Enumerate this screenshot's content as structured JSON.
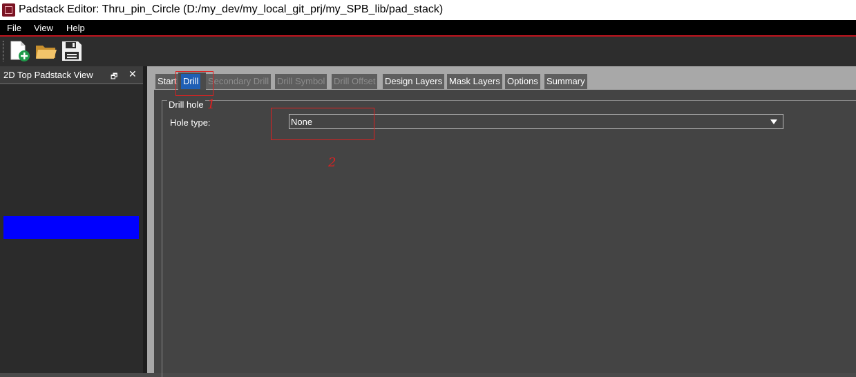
{
  "window": {
    "title": "Padstack Editor: Thru_pin_Circle  (D:/my_dev/my_local_git_prj/my_SPB_lib/pad_stack)"
  },
  "menu": [
    "File",
    "View",
    "Help"
  ],
  "toolbar": {
    "icons": [
      "new-file-icon",
      "open-folder-icon",
      "save-icon"
    ]
  },
  "side_panel": {
    "title": "2D Top Padstack View",
    "float_glyph": "🗗",
    "close_glyph": "✕"
  },
  "tabs": [
    {
      "label": "Start",
      "state": "normal"
    },
    {
      "label": "Drill",
      "state": "active"
    },
    {
      "label": "Secondary Drill",
      "state": "disabled"
    },
    {
      "label": "Drill Symbol",
      "state": "disabled"
    },
    {
      "label": "Drill Offset",
      "state": "disabled"
    },
    {
      "label": "Design Layers",
      "state": "normal"
    },
    {
      "label": "Mask Layers",
      "state": "normal"
    },
    {
      "label": "Options",
      "state": "normal"
    },
    {
      "label": "Summary",
      "state": "normal"
    }
  ],
  "drill": {
    "group_title": "Drill hole",
    "hole_type_label": "Hole type:",
    "hole_type_value": "None"
  },
  "annotations": {
    "one": "1",
    "two": "2",
    "color": "#e02020"
  },
  "colors": {
    "pad_shape": "#0000ff",
    "active_tab": "#1f5fb5",
    "menubar_accent": "#c0141e"
  }
}
